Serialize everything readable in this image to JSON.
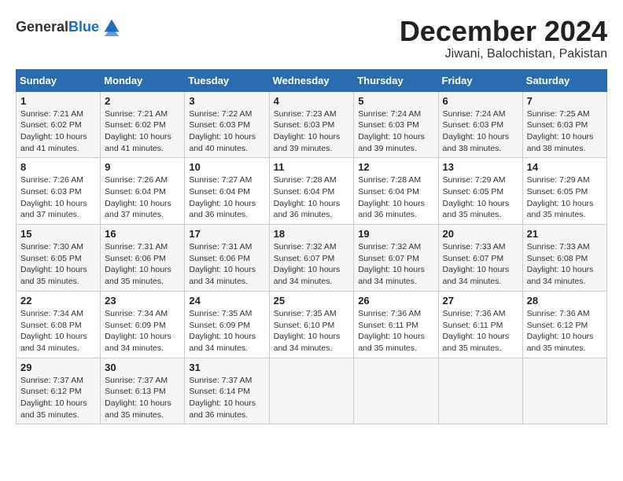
{
  "header": {
    "logo_general": "General",
    "logo_blue": "Blue",
    "month_title": "December 2024",
    "location": "Jiwani, Balochistan, Pakistan"
  },
  "weekdays": [
    "Sunday",
    "Monday",
    "Tuesday",
    "Wednesday",
    "Thursday",
    "Friday",
    "Saturday"
  ],
  "weeks": [
    [
      {
        "day": "1",
        "info": "Sunrise: 7:21 AM\nSunset: 6:02 PM\nDaylight: 10 hours and 41 minutes."
      },
      {
        "day": "2",
        "info": "Sunrise: 7:21 AM\nSunset: 6:02 PM\nDaylight: 10 hours and 41 minutes."
      },
      {
        "day": "3",
        "info": "Sunrise: 7:22 AM\nSunset: 6:03 PM\nDaylight: 10 hours and 40 minutes."
      },
      {
        "day": "4",
        "info": "Sunrise: 7:23 AM\nSunset: 6:03 PM\nDaylight: 10 hours and 39 minutes."
      },
      {
        "day": "5",
        "info": "Sunrise: 7:24 AM\nSunset: 6:03 PM\nDaylight: 10 hours and 39 minutes."
      },
      {
        "day": "6",
        "info": "Sunrise: 7:24 AM\nSunset: 6:03 PM\nDaylight: 10 hours and 38 minutes."
      },
      {
        "day": "7",
        "info": "Sunrise: 7:25 AM\nSunset: 6:03 PM\nDaylight: 10 hours and 38 minutes."
      }
    ],
    [
      {
        "day": "8",
        "info": "Sunrise: 7:26 AM\nSunset: 6:03 PM\nDaylight: 10 hours and 37 minutes."
      },
      {
        "day": "9",
        "info": "Sunrise: 7:26 AM\nSunset: 6:04 PM\nDaylight: 10 hours and 37 minutes."
      },
      {
        "day": "10",
        "info": "Sunrise: 7:27 AM\nSunset: 6:04 PM\nDaylight: 10 hours and 36 minutes."
      },
      {
        "day": "11",
        "info": "Sunrise: 7:28 AM\nSunset: 6:04 PM\nDaylight: 10 hours and 36 minutes."
      },
      {
        "day": "12",
        "info": "Sunrise: 7:28 AM\nSunset: 6:04 PM\nDaylight: 10 hours and 36 minutes."
      },
      {
        "day": "13",
        "info": "Sunrise: 7:29 AM\nSunset: 6:05 PM\nDaylight: 10 hours and 35 minutes."
      },
      {
        "day": "14",
        "info": "Sunrise: 7:29 AM\nSunset: 6:05 PM\nDaylight: 10 hours and 35 minutes."
      }
    ],
    [
      {
        "day": "15",
        "info": "Sunrise: 7:30 AM\nSunset: 6:05 PM\nDaylight: 10 hours and 35 minutes."
      },
      {
        "day": "16",
        "info": "Sunrise: 7:31 AM\nSunset: 6:06 PM\nDaylight: 10 hours and 35 minutes."
      },
      {
        "day": "17",
        "info": "Sunrise: 7:31 AM\nSunset: 6:06 PM\nDaylight: 10 hours and 34 minutes."
      },
      {
        "day": "18",
        "info": "Sunrise: 7:32 AM\nSunset: 6:07 PM\nDaylight: 10 hours and 34 minutes."
      },
      {
        "day": "19",
        "info": "Sunrise: 7:32 AM\nSunset: 6:07 PM\nDaylight: 10 hours and 34 minutes."
      },
      {
        "day": "20",
        "info": "Sunrise: 7:33 AM\nSunset: 6:07 PM\nDaylight: 10 hours and 34 minutes."
      },
      {
        "day": "21",
        "info": "Sunrise: 7:33 AM\nSunset: 6:08 PM\nDaylight: 10 hours and 34 minutes."
      }
    ],
    [
      {
        "day": "22",
        "info": "Sunrise: 7:34 AM\nSunset: 6:08 PM\nDaylight: 10 hours and 34 minutes."
      },
      {
        "day": "23",
        "info": "Sunrise: 7:34 AM\nSunset: 6:09 PM\nDaylight: 10 hours and 34 minutes."
      },
      {
        "day": "24",
        "info": "Sunrise: 7:35 AM\nSunset: 6:09 PM\nDaylight: 10 hours and 34 minutes."
      },
      {
        "day": "25",
        "info": "Sunrise: 7:35 AM\nSunset: 6:10 PM\nDaylight: 10 hours and 34 minutes."
      },
      {
        "day": "26",
        "info": "Sunrise: 7:36 AM\nSunset: 6:11 PM\nDaylight: 10 hours and 35 minutes."
      },
      {
        "day": "27",
        "info": "Sunrise: 7:36 AM\nSunset: 6:11 PM\nDaylight: 10 hours and 35 minutes."
      },
      {
        "day": "28",
        "info": "Sunrise: 7:36 AM\nSunset: 6:12 PM\nDaylight: 10 hours and 35 minutes."
      }
    ],
    [
      {
        "day": "29",
        "info": "Sunrise: 7:37 AM\nSunset: 6:12 PM\nDaylight: 10 hours and 35 minutes."
      },
      {
        "day": "30",
        "info": "Sunrise: 7:37 AM\nSunset: 6:13 PM\nDaylight: 10 hours and 35 minutes."
      },
      {
        "day": "31",
        "info": "Sunrise: 7:37 AM\nSunset: 6:14 PM\nDaylight: 10 hours and 36 minutes."
      },
      null,
      null,
      null,
      null
    ]
  ]
}
